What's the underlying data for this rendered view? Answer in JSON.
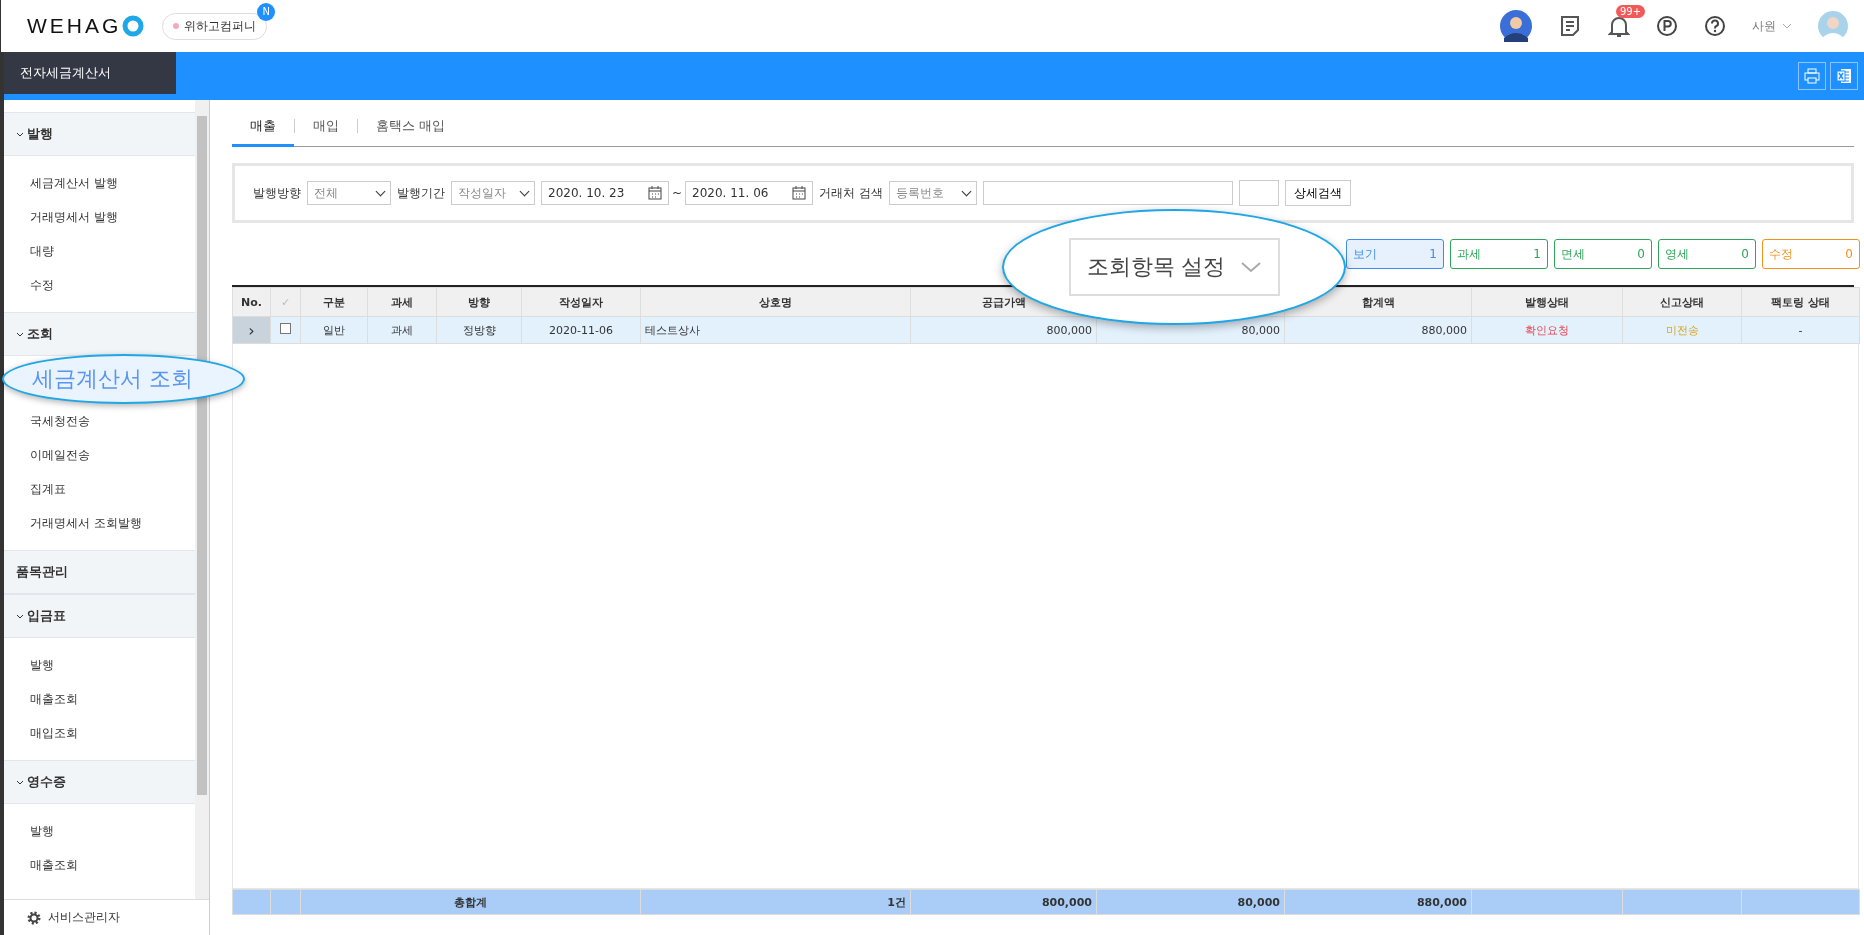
{
  "header": {
    "logo": "WEHAG",
    "company": {
      "name": "위하고컴퍼니",
      "badge": "N"
    },
    "notifications": "99+",
    "user_role": "사원"
  },
  "app_bar": {
    "title": "전자세금계산서"
  },
  "tabs": [
    {
      "label": "매출",
      "selected": true
    },
    {
      "label": "매입",
      "selected": false
    },
    {
      "label": "홈택스 매입",
      "selected": false
    }
  ],
  "sidebar": {
    "groups": [
      {
        "label": "발행",
        "expanded": true,
        "items": [
          {
            "label": "세금계산서 발행",
            "selected": false
          },
          {
            "label": "거래명세서 발행",
            "selected": false
          },
          {
            "label": "대량",
            "selected": false
          },
          {
            "label": "수정",
            "selected": false
          }
        ]
      },
      {
        "label": "조회",
        "expanded": true,
        "items": [
          {
            "label": "세금계산서 조회",
            "selected": true
          },
          {
            "label": "국세청전송",
            "selected": false
          },
          {
            "label": "이메일전송",
            "selected": false
          },
          {
            "label": "집계표",
            "selected": false
          },
          {
            "label": "거래명세서 조회발행",
            "selected": false
          }
        ]
      },
      {
        "label": "품목관리",
        "expanded": false
      },
      {
        "label": "입금표",
        "expanded": true,
        "items": [
          {
            "label": "발행",
            "selected": false
          },
          {
            "label": "매출조회",
            "selected": false
          },
          {
            "label": "매입조회",
            "selected": false
          }
        ]
      },
      {
        "label": "영수증",
        "expanded": true,
        "items": [
          {
            "label": "발행",
            "selected": false
          },
          {
            "label": "매출조회",
            "selected": false
          }
        ]
      }
    ],
    "footer": "서비스관리자"
  },
  "search": {
    "direction_label": "발행방향",
    "direction": "전체",
    "period_label": "발행기간",
    "period_type": "작성일자",
    "date_from": "2020. 10. 23",
    "tilde": "~",
    "date_to": "2020. 11. 06",
    "partner_label": "거래처 검색",
    "partner_type": "등록번호",
    "detail_button": "상세검색"
  },
  "column_settings": "조회항목 설정",
  "summary": [
    {
      "label": "보기",
      "count": "1",
      "color": "#3d8ee8"
    },
    {
      "label": "과세",
      "count": "1",
      "color": "#2ea55a"
    },
    {
      "label": "면세",
      "count": "0",
      "color": "#2ea55a"
    },
    {
      "label": "영세",
      "count": "0",
      "color": "#2ea55a"
    },
    {
      "label": "수정",
      "count": "0",
      "color": "#f0931e"
    }
  ],
  "table": {
    "columns": [
      {
        "label": "No."
      },
      {
        "label": "✓"
      },
      {
        "label": "구분"
      },
      {
        "label": "과세"
      },
      {
        "label": "방향"
      },
      {
        "label": "작성일자"
      },
      {
        "label": "상호명"
      },
      {
        "label": "공급가액"
      },
      {},
      {
        "label": "합계액"
      },
      {
        "label": "발행상태"
      },
      {
        "label": "신고상태"
      },
      {
        "label": "팩토링 상태"
      }
    ],
    "rows": [
      {
        "expand": "›",
        "checked": false,
        "selected": true,
        "type": "일반",
        "tax": "과세",
        "direction": "정방향",
        "date": "2020-11-06",
        "company": "테스트상사",
        "supply": "800,000",
        "vat": "80,000",
        "total": "880,000",
        "issue_status": "확인요청",
        "report_status": "미전송",
        "factoring": "-"
      }
    ],
    "footer": {
      "label": "총합계",
      "count": "1건",
      "supply": "800,000",
      "vat": "80,000",
      "total": "880,000"
    }
  }
}
